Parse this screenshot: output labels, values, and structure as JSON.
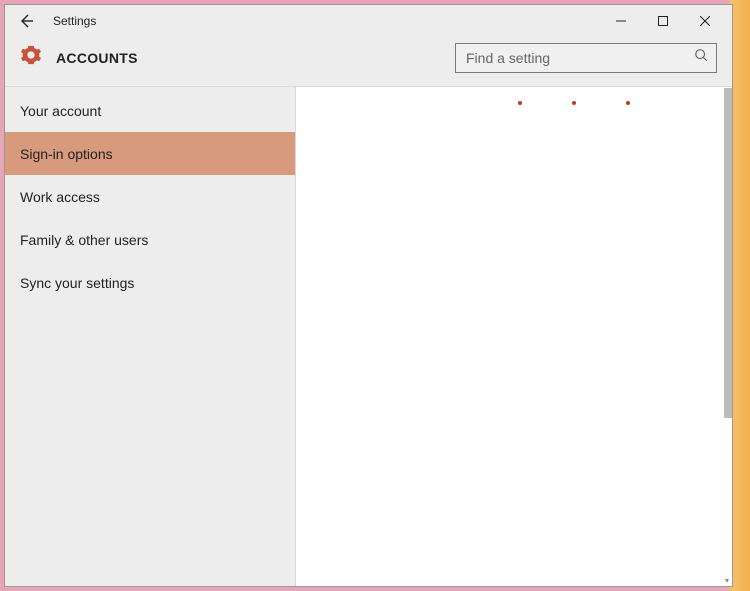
{
  "window": {
    "title": "Settings"
  },
  "header": {
    "title": "ACCOUNTS"
  },
  "search": {
    "placeholder": "Find a setting"
  },
  "sidebar": {
    "items": [
      {
        "label": "Your account"
      },
      {
        "label": "Sign-in options"
      },
      {
        "label": "Work access"
      },
      {
        "label": "Family & other users"
      },
      {
        "label": "Sync your settings"
      }
    ],
    "selected_index": 1
  }
}
